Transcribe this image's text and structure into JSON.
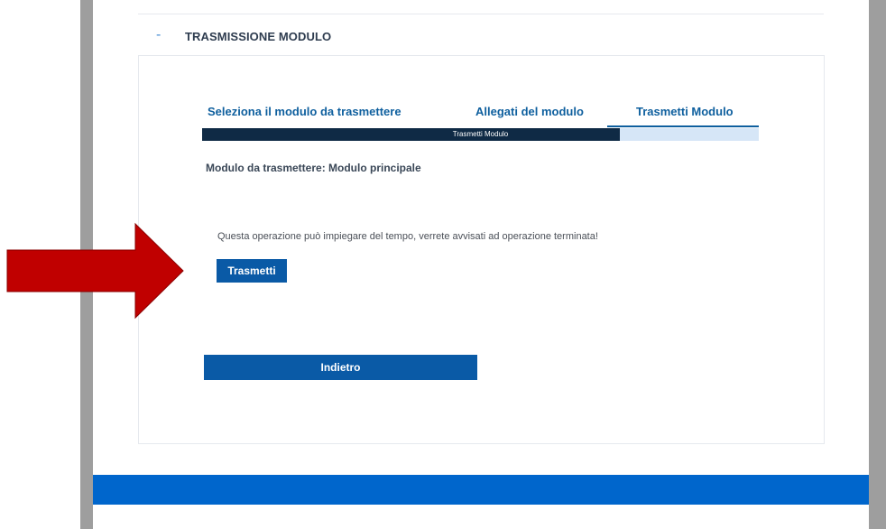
{
  "section": {
    "title": "TRASMISSIONE MODULO",
    "collapse_symbol": "-"
  },
  "tabs": [
    {
      "label": "Seleziona il modulo da trasmettere"
    },
    {
      "label": "Allegati del modulo"
    },
    {
      "label": "Trasmetti Modulo",
      "active": true
    }
  ],
  "progress": {
    "label": "Trasmetti Modulo",
    "fraction": 0.75
  },
  "module": {
    "label": "Modulo da trasmettere: Modulo principale"
  },
  "notice": "Questa operazione può impiegare del tempo, verrete avvisati ad operazione terminata!",
  "buttons": {
    "submit_label": "Trasmetti",
    "back_label": "Indietro"
  },
  "colors": {
    "primary": "#0a5aa6",
    "progress_fill": "#0f2a45",
    "progress_track": "#d6e6f7",
    "arrow": "#c00000",
    "footer": "#0066cc"
  }
}
